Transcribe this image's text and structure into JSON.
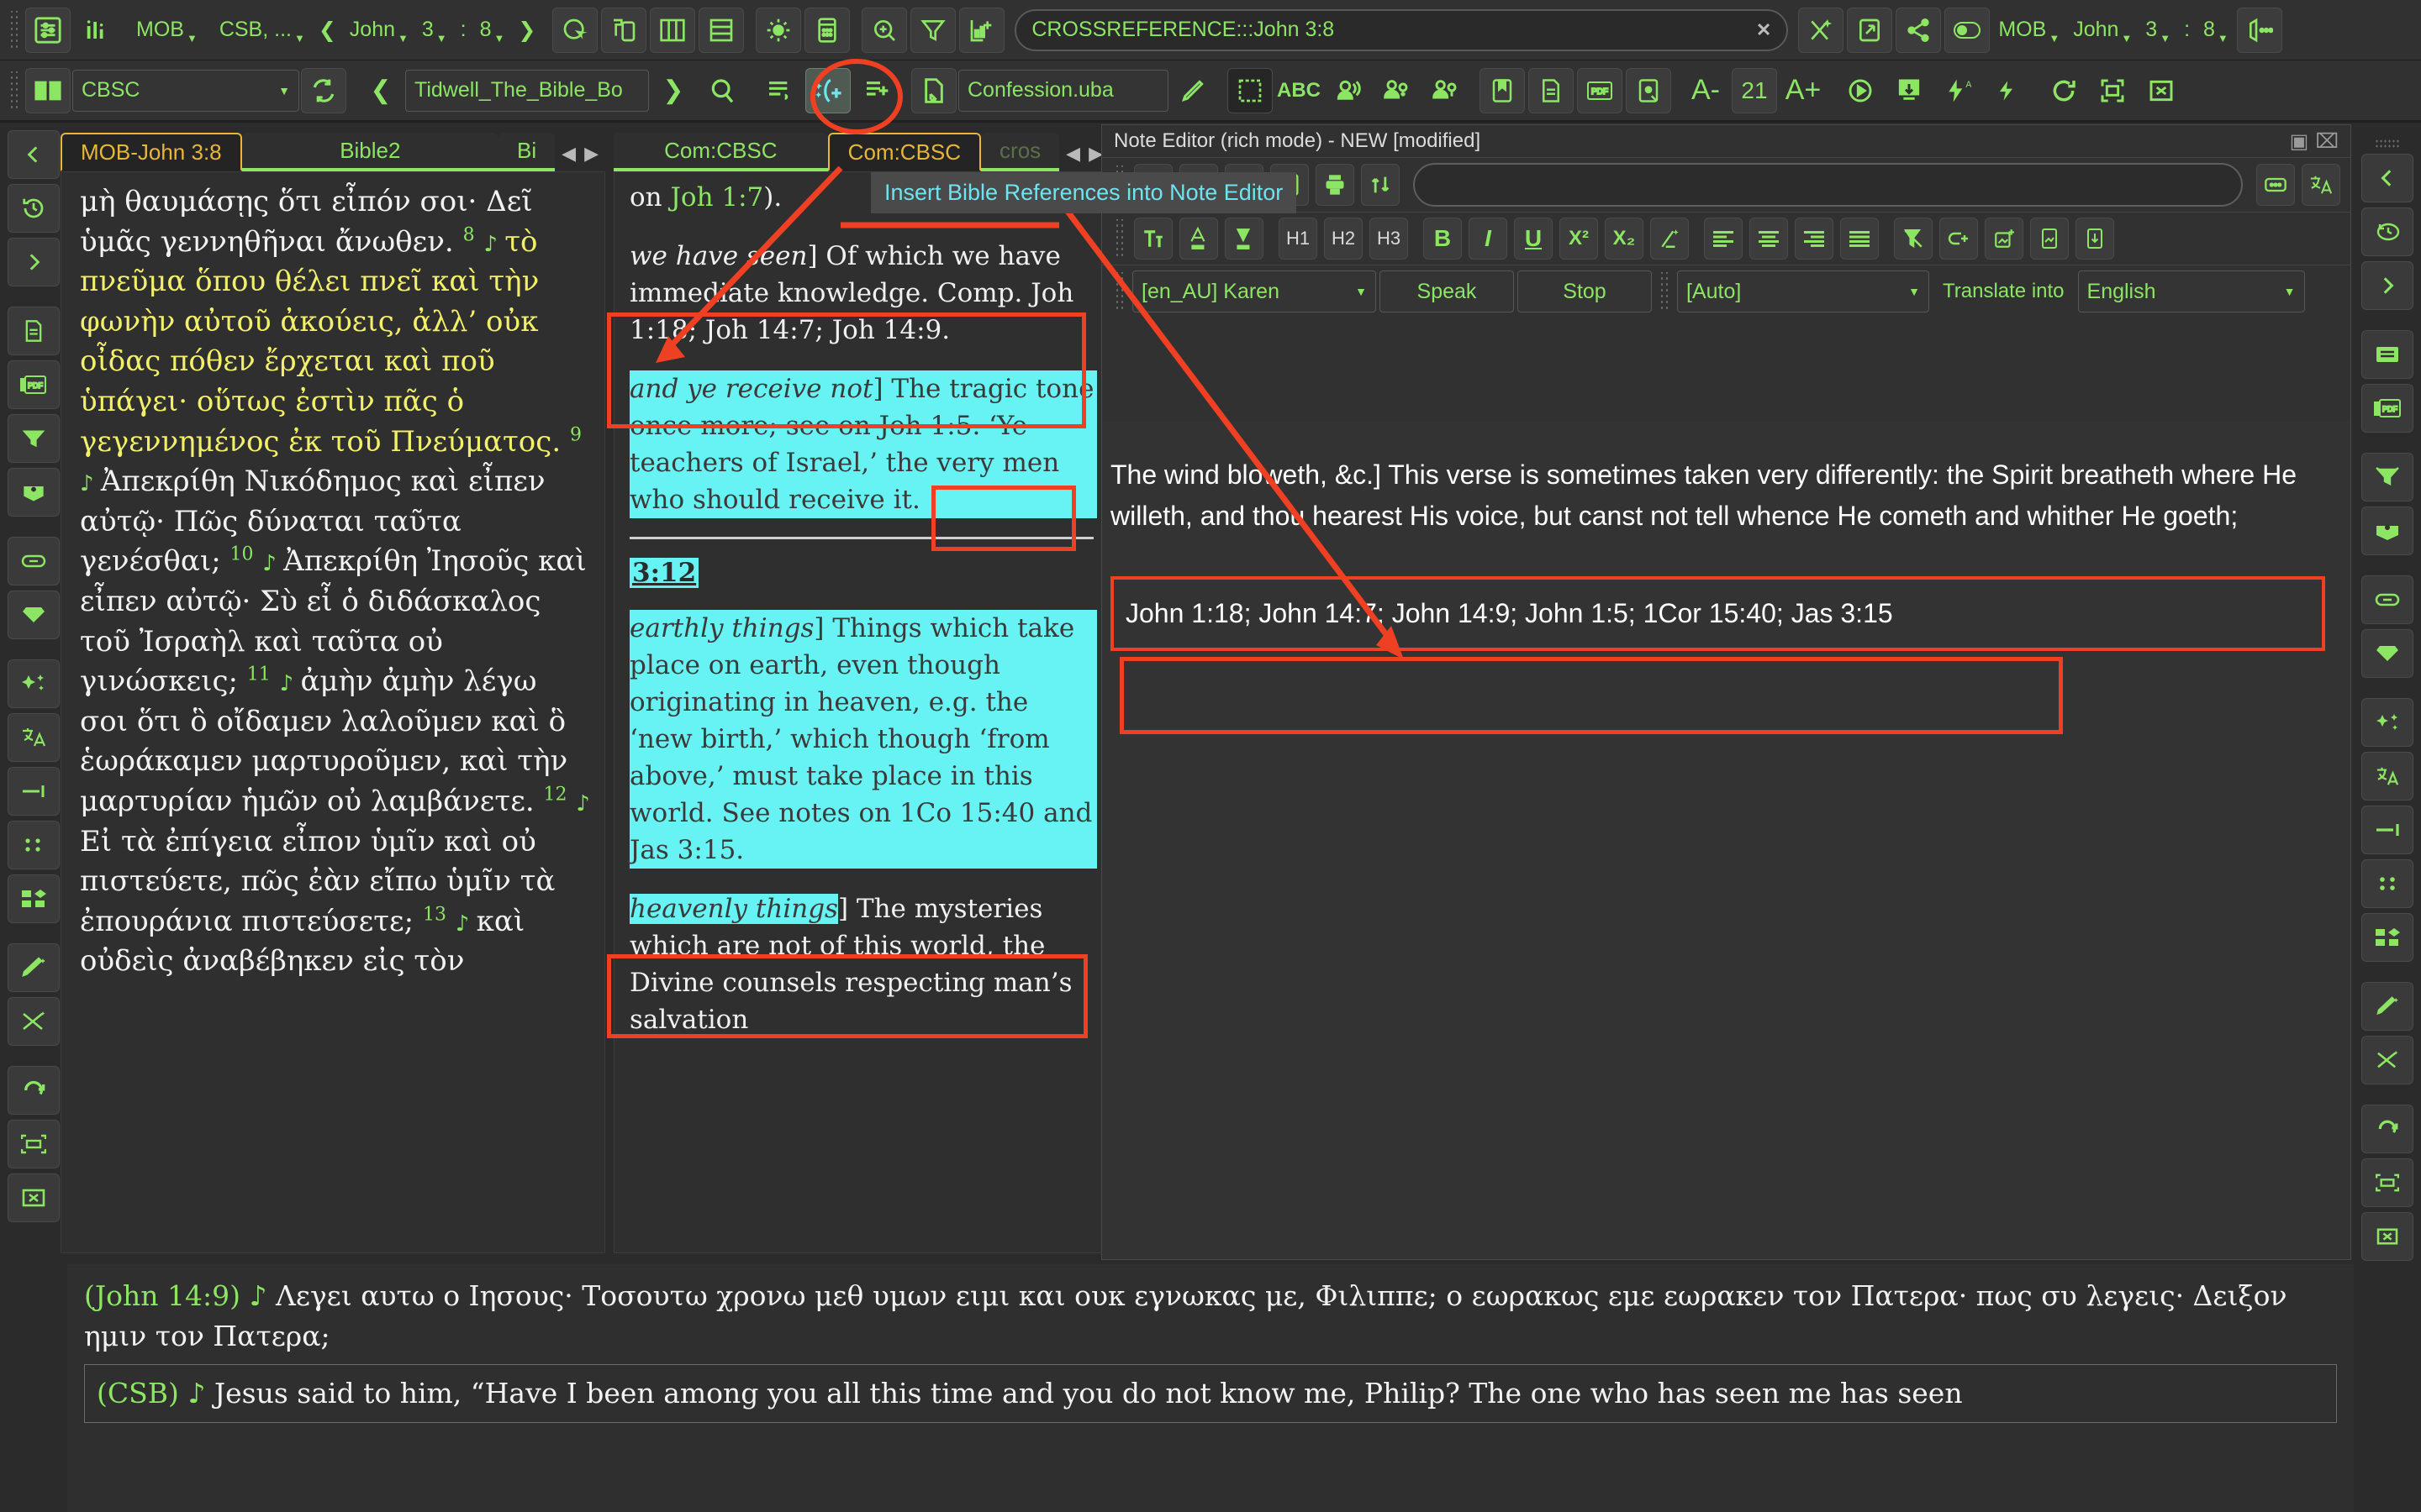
{
  "toolbar_top": {
    "bible_module": "MOB",
    "compare_modules": "CSB, ...",
    "book": "John",
    "chapter": "3",
    "verse": "8",
    "prev_symbol": "❮",
    "next_symbol": "❯",
    "search_value": "CROSSREFERENCE:::John 3:8",
    "clear_symbol": "✕",
    "right_module": "MOB",
    "right_book": "John",
    "right_chapter": "3",
    "right_verse": "8"
  },
  "toolbar_second": {
    "commentary_module": "CBSC",
    "book_name": "Tidwell_The_Bible_Bo",
    "prev_symbol": "❮",
    "next_symbol": "❯",
    "file_name": "Confession.uba",
    "font_minus": "A-",
    "font_size": "21",
    "font_plus": "A+",
    "abc_label": "ABC",
    "pdf_label": "PDF"
  },
  "tooltip": {
    "text": "Insert Bible References into Note Editor"
  },
  "left_panel": {
    "tabs": [
      {
        "label": "MOB-John 3:8",
        "selected": true
      },
      {
        "label": "Bible2",
        "selected": false
      },
      {
        "label": "Bi",
        "selected": false
      }
    ],
    "verses": [
      {
        "text": "μὴ θαυμάσῃς ὅτι εἶπόν σοι· Δεῖ ὑμᾶς γεννηθῆναι ἄνωθεν.",
        "number": "",
        "highlight": false
      },
      {
        "number": "8",
        "text": "τὸ πνεῦμα ὅπου θέλει πνεῖ καὶ τὴν φωνὴν αὐτοῦ ἀκούεις, ἀλλ’ οὐκ οἶδας πόθεν ἔρχεται καὶ ποῦ ὑπάγει· οὕτως ἐστὶν πᾶς ὁ γεγεννημένος ἐκ τοῦ Πνεύματος.",
        "highlight": true
      },
      {
        "number": "9",
        "text": "Ἀπεκρίθη Νικόδημος καὶ εἶπεν αὐτῷ· Πῶς δύναται ταῦτα γενέσθαι;",
        "highlight": false
      },
      {
        "number": "10",
        "text": "Ἀπεκρίθη Ἰησοῦς καὶ εἶπεν αὐτῷ· Σὺ εἶ ὁ διδάσκαλος τοῦ Ἰσραὴλ καὶ ταῦτα οὐ γινώσκεις;",
        "highlight": false
      },
      {
        "number": "11",
        "text": "ἀμὴν ἀμὴν λέγω σοι ὅτι ὃ οἴδαμεν λαλοῦμεν καὶ ὃ ἑωράκαμεν μαρτυροῦμεν, καὶ τὴν μαρτυρίαν ἡμῶν οὐ λαμβάνετε.",
        "highlight": false
      },
      {
        "number": "12",
        "text": "Εἰ τὰ ἐπίγεια εἶπον ὑμῖν καὶ οὐ πιστεύετε, πῶς ἐὰν εἴπω ὑμῖν τὰ ἐπουράνια πιστεύσετε;",
        "highlight": false
      },
      {
        "number": "13",
        "text": "καὶ οὐδεὶς ἀναβέβηκεν εἰς τὸν",
        "highlight": false
      }
    ]
  },
  "middle_panel": {
    "tabs": [
      {
        "label": "Com:CBSC",
        "selected": false
      },
      {
        "label": "Com:CBSC",
        "selected": true
      },
      {
        "label": "cros",
        "selected": false
      }
    ],
    "blocks": [
      {
        "lead": "",
        "text_plain": "on ",
        "ref": "Joh 1:7",
        "tail": ")."
      },
      {
        "lead": "we have seen",
        "text": "] Of which we have immediate knowledge. Comp. Joh 1:18; Joh 14:7; Joh 14:9."
      },
      {
        "lead": "and ye receive not",
        "text": "] The tragic tone once more; see on Joh 1:5. ‘Ye teachers of Israel,’ the very men who should receive it."
      },
      {
        "verse_label": "3:12"
      },
      {
        "lead": "earthly things",
        "text": "] Things which take place on earth, even though originating in heaven, e.g. the ‘new birth,’ which though ‘from above,’ must take place in this world. See notes on 1Co 15:40 and Jas 3:15."
      },
      {
        "lead": "heavenly things",
        "text": "] The mysteries which are not of this world, the Divine counsels respecting man’s salvation"
      }
    ]
  },
  "note_editor": {
    "title": "Note Editor (rich mode) - NEW [modified]",
    "restore_symbol": "▣",
    "close_symbol": "⌧",
    "search_value": "",
    "heading_buttons": [
      "H1",
      "H2",
      "H3"
    ],
    "format_buttons": [
      "B",
      "I",
      "U"
    ],
    "superscript": "X²",
    "subscript": "X₂",
    "voice": "[en_AU] Karen",
    "speak_label": "Speak",
    "stop_label": "Stop",
    "language_auto": "[Auto]",
    "translate_label": "Translate into",
    "translate_target": "English",
    "body_text": "The wind bloweth, &c.] This verse is sometimes taken very differently: the Spirit breatheth where He willeth, and thou hearest His voice, but canst not tell whence He cometh and whither He goeth;",
    "inserted_refs": "John 1:18; John 14:7; John 14:9; John 1:5; 1Cor 15:40; Jas 3:15"
  },
  "bottom_panel": {
    "ref_label": "(John 14:9)",
    "greek_text": "Λεγει αυτω ο Ιησους· Τοσουτω χρονω μεθ υμων ειμι και ουκ εγνωκας με, Φιλιππε; ο εωρακως εμε εωρακεν τον Πατερα· πως συ λεγεις· Δειξον ημιν τον Πατερα;",
    "csb_label": "(CSB)",
    "csb_text": "Jesus said to him, “Have I been among you all this time and you do not know me, Philip? The one who has seen me has seen"
  },
  "colors": {
    "accent_green": "#8ce563",
    "highlight_cyan": "#67f3f3",
    "annotation_red": "#ef4023",
    "selected_tab": "#e8b73a",
    "verse_yellow": "#f2f06a",
    "tooltip_text": "#6fe3ef"
  }
}
